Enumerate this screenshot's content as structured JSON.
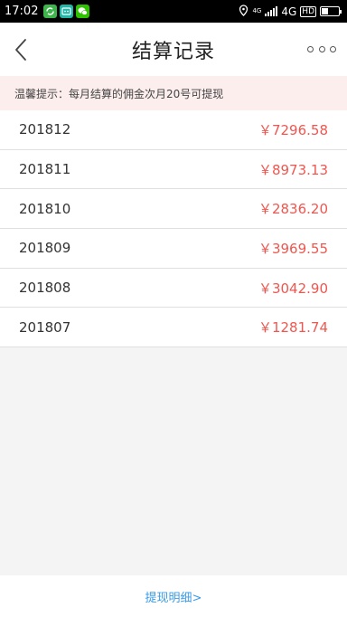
{
  "status_bar": {
    "time": "17:02",
    "network_small": "4G",
    "network": "4G",
    "hd": "HD",
    "app_icons": [
      "refresh-app-icon",
      "robot-app-icon",
      "wechat-icon"
    ]
  },
  "header": {
    "title": "结算记录",
    "back_icon": "chevron-left-icon",
    "more_icon": "more-dots-icon"
  },
  "notice": {
    "text": "温馨提示：每月结算的佣金次月20号可提现"
  },
  "records": [
    {
      "period": "201812",
      "amount": "￥7296.58"
    },
    {
      "period": "201811",
      "amount": "￥8973.13"
    },
    {
      "period": "201810",
      "amount": "￥2836.20"
    },
    {
      "period": "201809",
      "amount": "￥3969.55"
    },
    {
      "period": "201808",
      "amount": "￥3042.90"
    },
    {
      "period": "201807",
      "amount": "￥1281.74"
    }
  ],
  "footer": {
    "withdraw_link": "提现明细>"
  },
  "colors": {
    "amount": "#f0564f",
    "notice_bg": "#fdeeee",
    "link": "#3a9be8"
  }
}
